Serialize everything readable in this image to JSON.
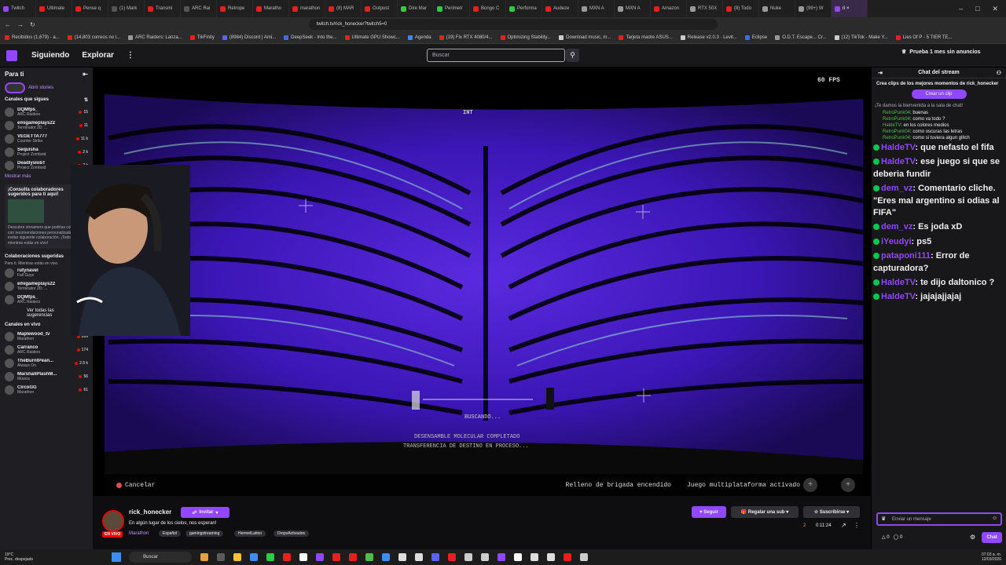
{
  "browser": {
    "tabs": [
      {
        "label": "Twitch",
        "color": "#9146ff"
      },
      {
        "label": "Ultimate",
        "color": "#e91e1e"
      },
      {
        "label": "Pense q",
        "color": "#e91e1e"
      },
      {
        "label": "(1) Mark",
        "color": "#555"
      },
      {
        "label": "Transmi",
        "color": "#e91e1e"
      },
      {
        "label": "ARC Rai",
        "color": "#555"
      },
      {
        "label": "Retrope",
        "color": "#e91e1e"
      },
      {
        "label": "Maratho",
        "color": "#e91e1e"
      },
      {
        "label": "marathon",
        "color": "#e91e1e"
      },
      {
        "label": "(8) MAR",
        "color": "#e91e1e"
      },
      {
        "label": "Outpost",
        "color": "#e91e1e"
      },
      {
        "label": "Dire Mar",
        "color": "#2ecc40"
      },
      {
        "label": "Perimetr",
        "color": "#2ecc40"
      },
      {
        "label": "Bongo C",
        "color": "#e91e1e"
      },
      {
        "label": "Performa",
        "color": "#2ecc40"
      },
      {
        "label": "Audeze",
        "color": "#e91e1e"
      },
      {
        "label": "MXN A",
        "color": "#999"
      },
      {
        "label": "MXN A",
        "color": "#999"
      },
      {
        "label": "Amazon",
        "color": "#e91e1e"
      },
      {
        "label": "RTX 50X",
        "color": "#999"
      },
      {
        "label": "(8) Todo",
        "color": "#e91e1e"
      },
      {
        "label": "Nuke",
        "color": "#999"
      },
      {
        "label": "(99+) W",
        "color": "#999"
      },
      {
        "label": "ri ×",
        "color": "#9146ff",
        "active": true
      }
    ],
    "url": "twitch.tv/rick_honecker?twitch5=0",
    "bookmarks": [
      {
        "label": "Recibidos (1,679) - a...",
        "color": "#e91e1e"
      },
      {
        "label": "(14,803 correos no l...",
        "color": "#e91e1e"
      },
      {
        "label": "ARC Raiders: Lanza...",
        "color": "#999"
      },
      {
        "label": "TikFinity",
        "color": "#e91e1e"
      },
      {
        "label": "(8984) Discord | Ami...",
        "color": "#5865f2"
      },
      {
        "label": "DeepSeek - Into the...",
        "color": "#4169e1"
      },
      {
        "label": "Ultimate GPU Showc...",
        "color": "#e91e1e"
      },
      {
        "label": "Agenda",
        "color": "#4285f4"
      },
      {
        "label": "(19) Fix RTX 4080/4...",
        "color": "#e91e1e"
      },
      {
        "label": "Optimizing Stability...",
        "color": "#e91e1e"
      },
      {
        "label": "Download music, m...",
        "color": "#ccc"
      },
      {
        "label": "Tarjeta madre ASUS...",
        "color": "#e91e1e"
      },
      {
        "label": "Release v2.0.3 · Levit...",
        "color": "#ccc"
      },
      {
        "label": "Eclipse",
        "color": "#4169e1"
      },
      {
        "label": "O.D.T. Escape... Cr...",
        "color": "#999"
      },
      {
        "label": "(12) TikTok - Make Y...",
        "color": "#ccc"
      },
      {
        "label": "Lies Of P - 5 TIER TE...",
        "color": "#e91e1e"
      }
    ]
  },
  "nav": {
    "following": "Siguiendo",
    "browse": "Explorar",
    "search_placeholder": "Buscar",
    "prime": "Prueba 1 mes sin anuncios"
  },
  "sidebar": {
    "for_you": "Para ti",
    "open_stories": "Abrir stories",
    "followed_header": "Canales que sigues",
    "followed": [
      {
        "name": "DQMfps_",
        "game": "ARC Raiders",
        "viewers": "15"
      },
      {
        "name": "emigameplays22",
        "game": "Terminator 2D: ...",
        "viewers": "11"
      },
      {
        "name": "VEGETTA777",
        "game": "Counter-Strike",
        "viewers": "11 k"
      },
      {
        "name": "Sequisha",
        "game": "Project Zomboid",
        "viewers": "2 k"
      },
      {
        "name": "DeadlyslobT",
        "game": "Project Zomboid",
        "viewers": "2 k"
      }
    ],
    "show_more": "Mostrar más",
    "promo_title": "¡Consulta colaboradores sugeridos para ti aquí!",
    "promo_text": "Descubre streamers que podrías colaborar con recomendaciones personalizadas, raid, invitar siguiente colaboración. ¡Todo mientras estás en vivo!",
    "collab_header": "Colaboraciones sugeridas",
    "collab_sub": "Para ti. Mientras estás en vivo.",
    "collabs": [
      {
        "name": "rutynavel",
        "game": "Fall Guys",
        "viewers": "9"
      },
      {
        "name": "emigameplays22",
        "game": "Terminator 2D: ...",
        "viewers": "11"
      },
      {
        "name": "DQMfps_",
        "game": "ARC Raiders",
        "viewers": "15"
      }
    ],
    "see_all": "Ver todas las sugerencias",
    "live_header": "Canales en vivo",
    "live": [
      {
        "name": "Maplewood_tv",
        "game": "Marathon",
        "viewers": "289"
      },
      {
        "name": "Carranco",
        "game": "ARC Raiders",
        "viewers": "174"
      },
      {
        "name": "TheBurntPean...",
        "game": "Always On",
        "viewers": "2.5 k"
      },
      {
        "name": "MarshallPlashM...",
        "game": "Música",
        "viewers": "56"
      },
      {
        "name": "CircoGG",
        "game": "Marathon",
        "viewers": "61"
      }
    ]
  },
  "video": {
    "fps": "60 FPS",
    "status_searching": "BUSCANDO...",
    "status_line1": "DESENSAMBLE MOLECULAR COMPLETADO",
    "status_line2": "TRANSFERENCIA DE DESTINO EN PROCESO...",
    "hud_badge": "INT",
    "cancel": "Cancelar",
    "fill_squad": "Relleno de brigada encendido",
    "crossplay": "Juego multiplataforma activado"
  },
  "stream": {
    "live_badge": "EN VIVO",
    "streamer": "rick_honecker",
    "invite": "Invitar",
    "title": "En algún lugar de los cielos, nos esperan!",
    "category": "Marathon",
    "tags": [
      "Español",
      "gamingstreaming",
      "HermetLatino",
      "DropsActivados"
    ],
    "follow": "Seguir",
    "gift_sub": "Regalar una sub",
    "subscribe": "Suscribirse",
    "viewers": "2",
    "uptime": "0:11:24"
  },
  "chat": {
    "header": "Chat del stream",
    "clip_prompt": "Crea clips de los mejores momentos de rick_honecker",
    "clip_button": "Crear un clip",
    "welcome": "¡Te damos la bienvenida a la sala de chat!",
    "small_messages": [
      {
        "user": "RetroPunk04",
        "text": "buenas"
      },
      {
        "user": "RetroPunk04",
        "text": "como va todo ?"
      },
      {
        "user": "HaldeTV",
        "text": "en los colores medios"
      },
      {
        "user": "RetroPunk04",
        "text": "como oscuras las letras"
      },
      {
        "user": "RetroPunk04",
        "text": "como si tuviera algun glitch"
      }
    ],
    "big_messages": [
      {
        "user": "HaldeTV",
        "text": "que nefasto el fifa"
      },
      {
        "user": "HaldeTV",
        "text": "ese juego si que se deberia fundir"
      },
      {
        "user": "dem_vz",
        "text": "Comentario cliche. \"Eres mal argentino si odias al FIFA\""
      },
      {
        "user": "dem_vz",
        "text": "Es joda xD"
      },
      {
        "user": "iYeudyi",
        "text": "ps5"
      },
      {
        "user": "pataponi111",
        "text": "Error de capturadora?"
      },
      {
        "user": "HaldeTV",
        "text": "te dijo daltonico ?"
      },
      {
        "user": "HaldeTV",
        "text": "jajajajjajaj"
      }
    ],
    "input_placeholder": "Enviar un mensaje",
    "chat_button": "Chat",
    "points_a": "0",
    "points_b": "0"
  },
  "taskbar": {
    "temp": "19°C",
    "weather": "Prec. despejado",
    "search": "Buscar",
    "time": "07:03 a. m.",
    "date": "12/03/2026"
  }
}
